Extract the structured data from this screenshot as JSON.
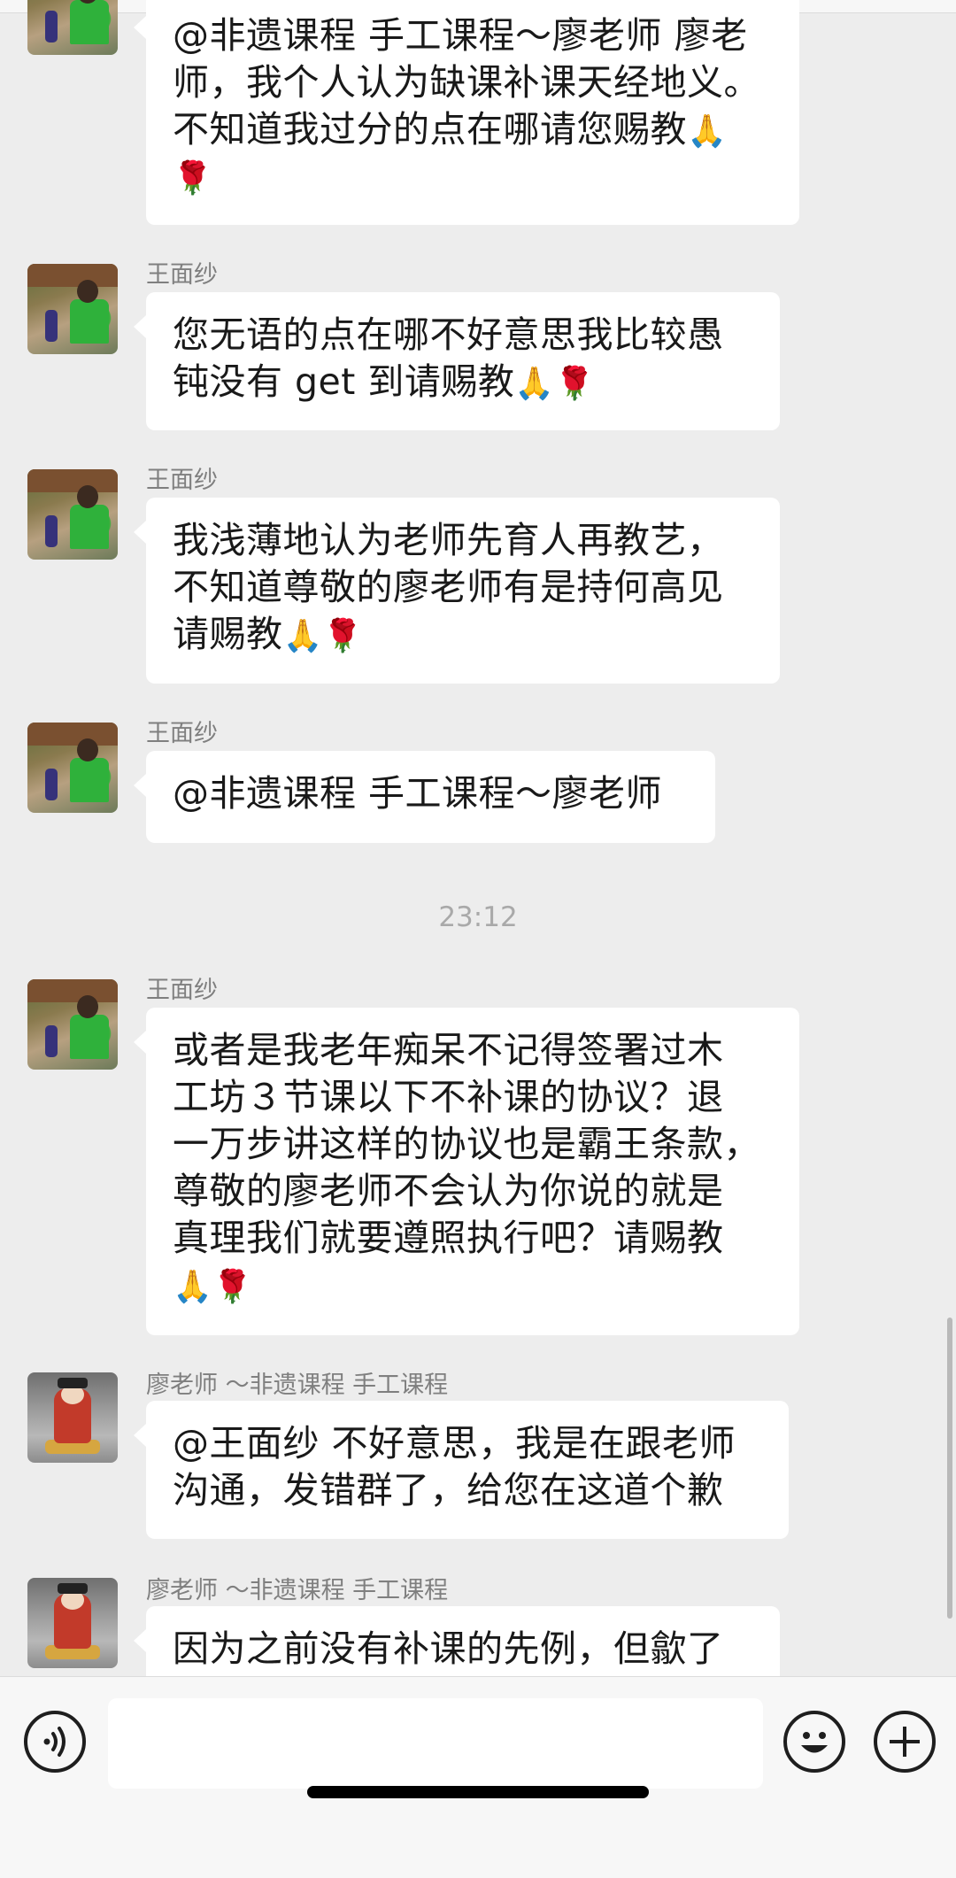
{
  "messages": [
    {
      "sender": "",
      "lines": [
        "@非遗课程 手工课程～廖老师 廖老",
        "师，我个人认为缺课补课天经地义。",
        "不知道我过分的点在哪请您赐教",
        ""
      ],
      "emoji": [
        "🙏",
        "🌹"
      ]
    },
    {
      "sender": "王面纱",
      "lines": [
        "您无语的点在哪不好意思我比较愚",
        "钝没有 get 到请赐教"
      ],
      "emoji": [
        "🙏",
        "🌹"
      ]
    },
    {
      "sender": "王面纱",
      "lines": [
        "我浅薄地认为老师先育人再教艺，",
        "不知道尊敬的廖老师有是持何高见",
        "请赐教"
      ],
      "emoji": [
        "🙏",
        "🌹"
      ]
    },
    {
      "sender": "王面纱",
      "lines": [
        "@非遗课程 手工课程～廖老师"
      ],
      "emoji": []
    },
    {
      "sender": "王面纱",
      "lines": [
        "或者是我老年痴呆不记得签署过木",
        "工坊３节课以下不补课的协议？退",
        "一万步讲这样的协议也是霸王条款，",
        "尊敬的廖老师不会认为你说的就是",
        "真理我们就要遵照执行吧？请赐教",
        ""
      ],
      "emoji": [
        "🙏",
        "🌹"
      ]
    },
    {
      "sender": "廖老师 ～非遗课程 手工课程",
      "lines": [
        "@王面纱 不好意思，我是在跟老师",
        "沟通，发错群了，给您在这道个歉"
      ],
      "emoji": []
    },
    {
      "sender": "廖老师 ～非遗课程 手工课程",
      "lines": [
        "因为之前没有补课的先例，但歙了"
      ],
      "emoji": []
    }
  ],
  "timestamp": "23:12",
  "input": {
    "placeholder": ""
  },
  "icons": {
    "voice": "voice-icon",
    "emoji": "emoji-icon",
    "plus": "plus-icon"
  }
}
